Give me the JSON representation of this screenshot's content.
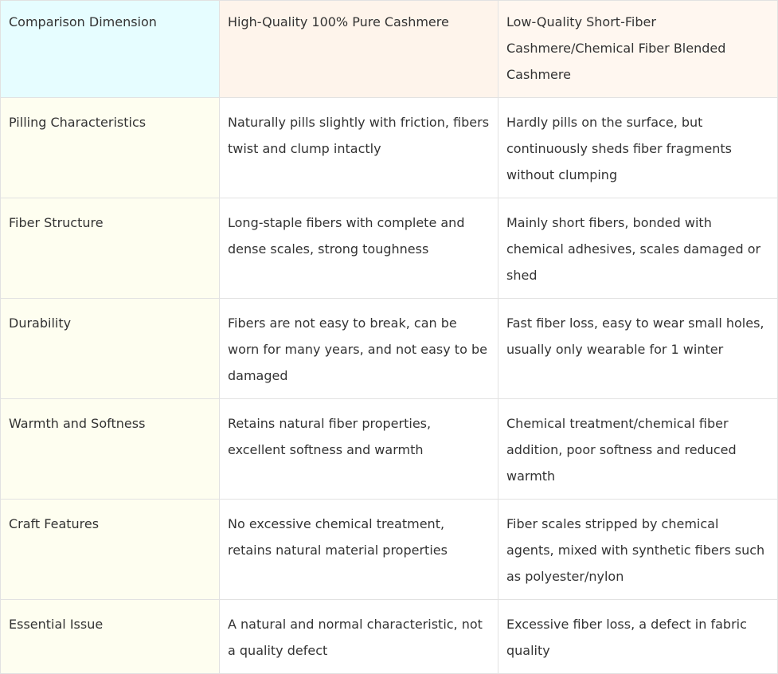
{
  "table": {
    "headers": [
      "Comparison Dimension",
      "High-Quality 100% Pure Cashmere",
      "Low-Quality Short-Fiber Cashmere/Chemical Fiber Blended Cashmere"
    ],
    "rows": [
      {
        "dimension": "Pilling Characteristics",
        "high": "Naturally pills slightly with friction, fibers twist and clump intactly",
        "low": "Hardly pills on the surface, but continuously sheds fiber fragments without clumping"
      },
      {
        "dimension": "Fiber Structure",
        "high": "Long-staple fibers with complete and dense scales, strong toughness",
        "low": "Mainly short fibers, bonded with chemical adhesives, scales damaged or shed"
      },
      {
        "dimension": "Durability",
        "high": "Fibers are not easy to break, can be worn for many years, and not easy to be damaged",
        "low": "Fast fiber loss, easy to wear small holes, usually only wearable for 1 winter"
      },
      {
        "dimension": "Warmth and Softness",
        "high": "Retains natural fiber properties, excellent softness and warmth",
        "low": "Chemical treatment/chemical fiber addition, poor softness and reduced warmth"
      },
      {
        "dimension": "Craft Features",
        "high": "No excessive chemical treatment, retains natural material properties",
        "low": "Fiber scales stripped by chemical agents, mixed with synthetic fibers such as polyester/nylon"
      },
      {
        "dimension": "Essential Issue",
        "high": "A natural and normal characteristic, not a quality defect",
        "low": "Excessive fiber loss, a defect in fabric quality"
      }
    ]
  },
  "colors": {
    "header_dimension_bg": "#e6fdff",
    "header_high_bg": "#fef4eb",
    "header_low_bg": "#fff7f0",
    "dimension_column_bg": "#fefef0",
    "border": "#e2e2e2",
    "text": "#333333"
  }
}
